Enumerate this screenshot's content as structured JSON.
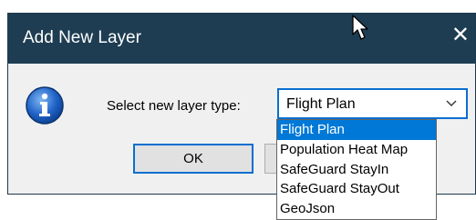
{
  "dialog": {
    "title": "Add New Layer",
    "close_icon": "close-icon",
    "prompt": "Select new layer type:",
    "selected_value": "Flight Plan",
    "ok_label": "OK"
  },
  "dropdown": {
    "options": [
      "Flight Plan",
      "Population Heat Map",
      "SafeGuard StayIn",
      "SafeGuard StayOut",
      "GeoJson"
    ],
    "highlighted_index": 0
  },
  "colors": {
    "titlebar": "#1e3d52",
    "accent": "#0078d7",
    "dialog_bg": "#f0f0f0"
  }
}
